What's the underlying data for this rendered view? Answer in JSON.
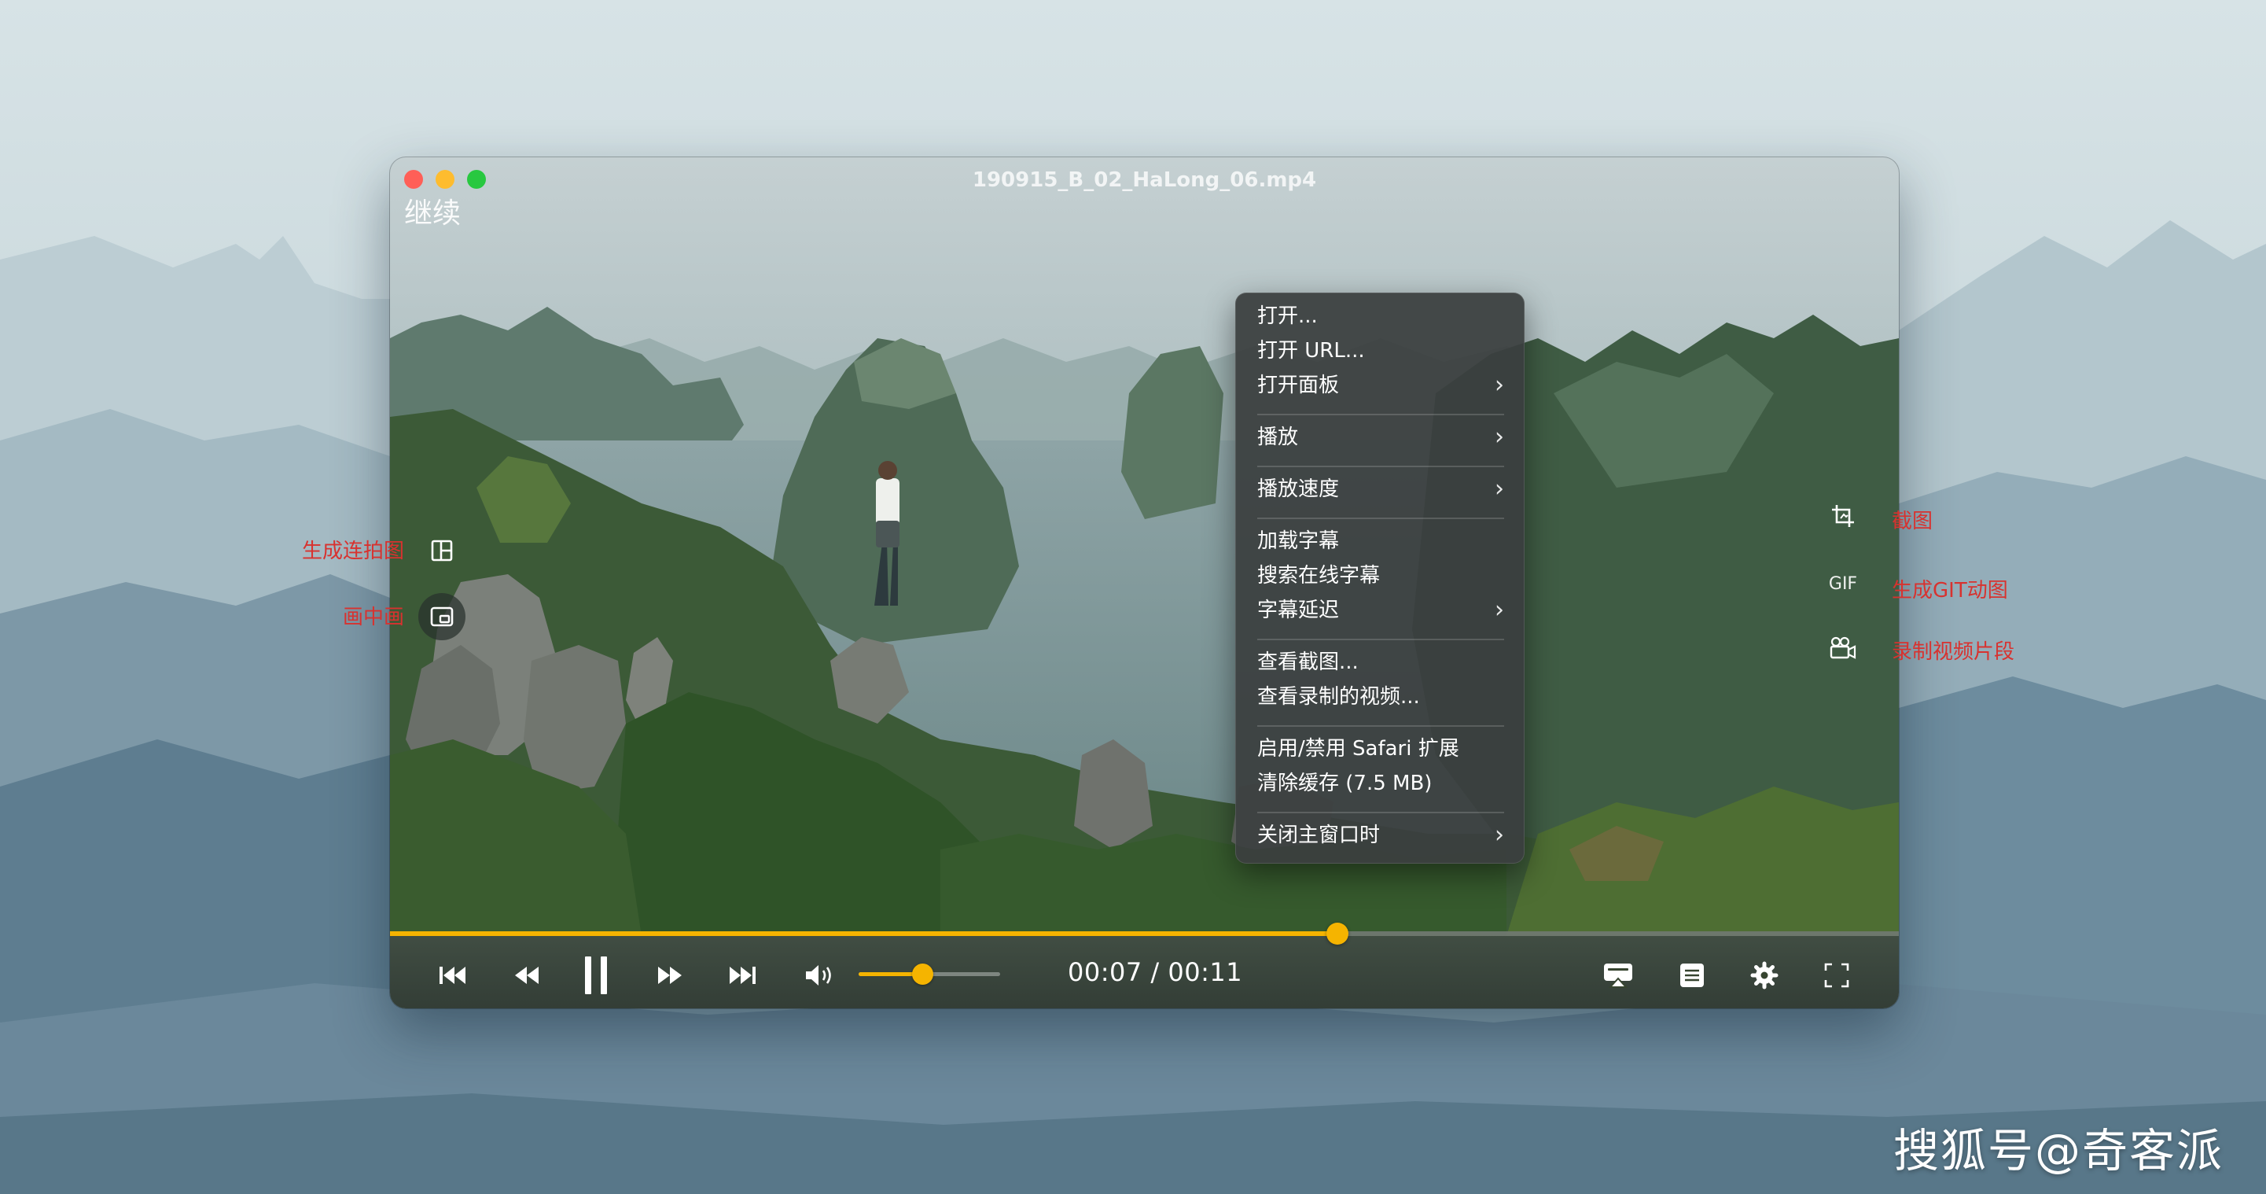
{
  "window": {
    "title": "190915_B_02_HaLong_06.mp4",
    "resume_label": "继续"
  },
  "side_tools": {
    "left": [
      {
        "name": "contact-sheet-icon",
        "callout": "生成连拍图"
      },
      {
        "name": "picture-in-picture-icon",
        "callout": "画中画"
      }
    ],
    "right": [
      {
        "name": "crop-screenshot-icon",
        "callout": "截图"
      },
      {
        "name": "gif-icon",
        "label": "GIF",
        "callout": "生成GIT动图"
      },
      {
        "name": "video-camera-icon",
        "callout": "录制视频片段"
      }
    ]
  },
  "context_menu": {
    "items": [
      {
        "label": "打开...",
        "submenu": false
      },
      {
        "label": "打开 URL...",
        "submenu": false
      },
      {
        "label": "打开面板",
        "submenu": true
      },
      {
        "label": "播放",
        "submenu": true
      },
      {
        "label": "播放速度",
        "submenu": true
      },
      {
        "label": "加载字幕",
        "submenu": false
      },
      {
        "label": "搜索在线字幕",
        "submenu": false
      },
      {
        "label": "字幕延迟",
        "submenu": true
      },
      {
        "label": "查看截图...",
        "submenu": false
      },
      {
        "label": "查看录制的视频...",
        "submenu": false
      },
      {
        "label": "启用/禁用 Safari 扩展",
        "submenu": false
      },
      {
        "label": "清除缓存 (7.5 MB)",
        "submenu": false
      },
      {
        "label": "关闭主窗口时",
        "submenu": true
      }
    ],
    "chevron": "›"
  },
  "playback": {
    "current_time": "00:07",
    "total_time": "00:11",
    "time_display": "00:07 / 00:11",
    "progress_fraction": 0.628,
    "volume_fraction": 0.45,
    "accent_color": "#f5b400"
  },
  "controls": {
    "left": [
      "skip-previous-icon",
      "rewind-icon",
      "pause-icon",
      "fast-forward-icon",
      "skip-next-icon",
      "volume-icon"
    ],
    "right": [
      "airplay-icon",
      "playlist-icon",
      "settings-icon",
      "fullscreen-icon"
    ]
  },
  "watermark": "搜狐号@奇客派"
}
